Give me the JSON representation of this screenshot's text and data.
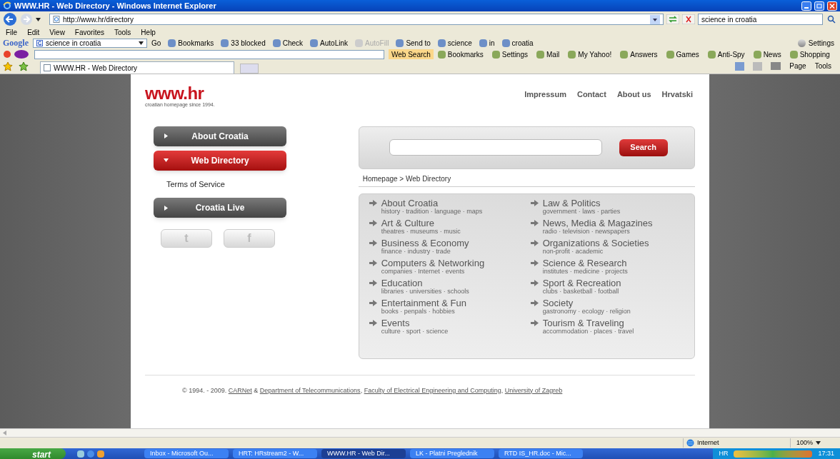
{
  "window": {
    "title": "WWW.HR - Web Directory - Windows Internet Explorer"
  },
  "address_bar": {
    "url": "http://www.hr/directory",
    "search": "science in croatia"
  },
  "menu": [
    "File",
    "Edit",
    "View",
    "Favorites",
    "Tools",
    "Help"
  ],
  "google_toolbar": {
    "logo": "Google",
    "query": "science in croatia",
    "items": [
      {
        "label": "Go",
        "disabled": false
      },
      {
        "label": "Bookmarks",
        "disabled": false
      },
      {
        "label": "33 blocked",
        "disabled": false
      },
      {
        "label": "Check",
        "disabled": false
      },
      {
        "label": "AutoLink",
        "disabled": false
      },
      {
        "label": "AutoFill",
        "disabled": true
      },
      {
        "label": "Send to",
        "disabled": false
      },
      {
        "label": "science",
        "disabled": false
      },
      {
        "label": "in",
        "disabled": false
      },
      {
        "label": "croatia",
        "disabled": false
      }
    ],
    "settings": "Settings"
  },
  "yahoo_toolbar": {
    "search_button": "Web Search",
    "items": [
      "Bookmarks",
      "Settings",
      "Mail",
      "My Yahoo!",
      "Answers",
      "Games",
      "Anti-Spy",
      "News",
      "Shopping"
    ]
  },
  "tab": {
    "title": "WWW.HR - Web Directory"
  },
  "command_bar": [
    "Page",
    "Tools"
  ],
  "site": {
    "logo": "www.hr",
    "tagline": "croatian homepage since 1994.",
    "top_links": [
      "Impressum",
      "Contact",
      "About us",
      "Hrvatski"
    ],
    "side_nav": [
      {
        "label": "About Croatia",
        "selected": false,
        "kind": "button"
      },
      {
        "label": "Web Directory",
        "selected": true,
        "kind": "button"
      },
      {
        "label": "Terms of Service",
        "selected": false,
        "kind": "link"
      },
      {
        "label": "Croatia Live",
        "selected": false,
        "kind": "button"
      }
    ],
    "social": [
      "t",
      "f"
    ],
    "search_button": "Search",
    "breadcrumb": "Homepage > Web Directory",
    "categories": [
      {
        "title": "About Croatia",
        "sub": "history · tradition · language · maps"
      },
      {
        "title": "Law & Politics",
        "sub": "government · laws · parties"
      },
      {
        "title": "Art & Culture",
        "sub": "theatres · museums · music"
      },
      {
        "title": "News, Media & Magazines",
        "sub": "radio · television · newspapers"
      },
      {
        "title": "Business & Economy",
        "sub": "finance · industry · trade"
      },
      {
        "title": "Organizations & Societies",
        "sub": "non-profit · academic"
      },
      {
        "title": "Computers & Networking",
        "sub": "companies · Internet · events"
      },
      {
        "title": "Science & Research",
        "sub": "institutes · medicine · projects"
      },
      {
        "title": "Education",
        "sub": "libraries · universities · schools"
      },
      {
        "title": "Sport & Recreation",
        "sub": "clubs · basketball · football"
      },
      {
        "title": "Entertainment & Fun",
        "sub": "books · penpals · hobbies"
      },
      {
        "title": "Society",
        "sub": "gastronomy · ecology · religion"
      },
      {
        "title": "Events",
        "sub": "culture · sport · science"
      },
      {
        "title": "Tourism & Traveling",
        "sub": "accommodation · places · travel"
      }
    ],
    "footer": [
      {
        "text": "© 1994. - 2009. ",
        "link": false
      },
      {
        "text": "CARNet",
        "link": true
      },
      {
        "text": " & ",
        "link": false
      },
      {
        "text": "Department of Telecommunications",
        "link": true
      },
      {
        "text": ", ",
        "link": false
      },
      {
        "text": "Faculty of Electrical Engineering and Computing",
        "link": true
      },
      {
        "text": ", ",
        "link": false
      },
      {
        "text": "University of Zagreb",
        "link": true
      }
    ]
  },
  "status_bar": {
    "zone": "Internet",
    "zoom": "100%"
  },
  "taskbar": {
    "start": "start",
    "tasks": [
      {
        "label": "Inbox - Microsoft Ou...",
        "selected": false
      },
      {
        "label": "HRT: HRstream2 - W...",
        "selected": false
      },
      {
        "label": "WWW.HR - Web Dir...",
        "selected": true
      },
      {
        "label": "LK - Platni Preglednik",
        "selected": false
      },
      {
        "label": "RTD IS_HR.doc - Mic...",
        "selected": false
      }
    ],
    "language": "HR",
    "clock": "17:31"
  }
}
